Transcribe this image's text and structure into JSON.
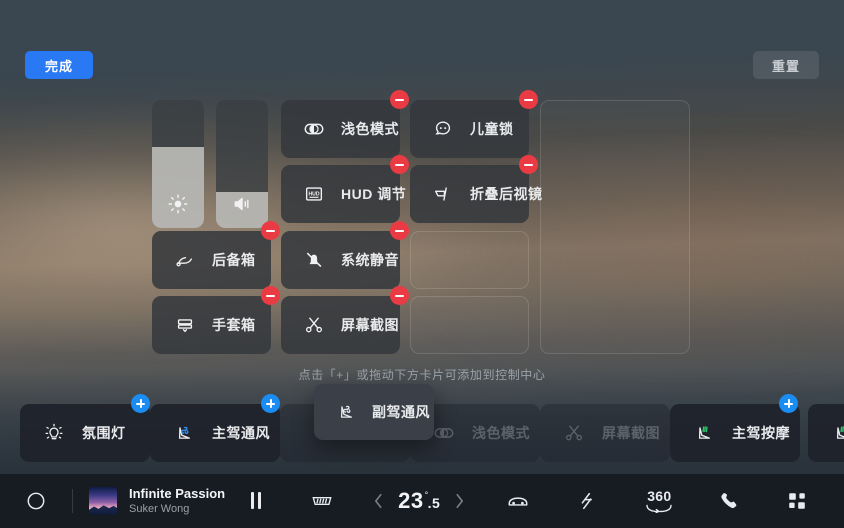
{
  "header": {
    "done_label": "完成",
    "reset_label": "重置"
  },
  "editor": {
    "hint": "点击「+」或拖动下方卡片可添加到控制中心",
    "sliders": [
      {
        "name": "brightness",
        "icon": "brightness-icon",
        "value": 63
      },
      {
        "name": "volume",
        "icon": "volume-icon",
        "value": 28
      }
    ],
    "tiles": [
      {
        "label": "浅色模式",
        "icon": "light-mode-toggle-icon",
        "badge": "minus"
      },
      {
        "label": "儿童锁",
        "icon": "child-lock-icon",
        "badge": "minus"
      },
      {
        "label": "HUD 调节",
        "icon": "hud-icon",
        "badge": "minus"
      },
      {
        "label": "折叠后视镜",
        "icon": "fold-mirror-icon",
        "badge": "minus"
      },
      {
        "label": "后备箱",
        "icon": "trunk-icon",
        "badge": "minus"
      },
      {
        "label": "系统静音",
        "icon": "mute-icon",
        "badge": "minus"
      },
      {
        "label": "手套箱",
        "icon": "glovebox-icon",
        "badge": "minus"
      },
      {
        "label": "屏幕截图",
        "icon": "screenshot-icon",
        "badge": "minus"
      }
    ]
  },
  "tray": {
    "cards": [
      {
        "label": "氛围灯",
        "icon": "ambient-light-icon",
        "badge": "plus",
        "state": "enabled"
      },
      {
        "label": "主驾通风",
        "icon": "driver-ventilation-icon",
        "badge": "plus",
        "state": "enabled"
      },
      {
        "label": "浅色模式",
        "icon": "light-mode-toggle-icon",
        "badge": "none",
        "state": "disabled"
      },
      {
        "label": "屏幕截图",
        "icon": "screenshot-icon",
        "badge": "none",
        "state": "disabled"
      },
      {
        "label": "主驾按摩",
        "icon": "driver-massage-icon",
        "badge": "plus",
        "state": "enabled"
      },
      {
        "label": "",
        "icon": "passenger-massage-icon",
        "badge": "none",
        "state": "enabled"
      }
    ],
    "dragging_card": {
      "label": "副驾通风",
      "icon": "passenger-ventilation-icon"
    }
  },
  "statusbar": {
    "home_icon": "home-circle-icon",
    "media": {
      "title": "Infinite Passion",
      "artist": "Suker Wong",
      "play_state_icon": "pause-icon"
    },
    "climate": {
      "defrost_icon": "rear-defrost-icon",
      "decrease_icon": "chevron-left-icon",
      "temperature": "23",
      "temperature_decimal": ".5",
      "degree_symbol": "°",
      "increase_icon": "chevron-right-icon",
      "seat_icon": "car-seat-icon"
    },
    "shortcuts": [
      {
        "icon": "energy-icon",
        "label": ""
      },
      {
        "icon": "camera-360-icon",
        "label": "360"
      },
      {
        "icon": "phone-icon",
        "label": ""
      },
      {
        "icon": "apps-grid-icon",
        "label": ""
      }
    ]
  },
  "colors": {
    "accent_blue": "#2979f5",
    "badge_red": "#ea3b44",
    "badge_blue": "#1b8cf2"
  }
}
